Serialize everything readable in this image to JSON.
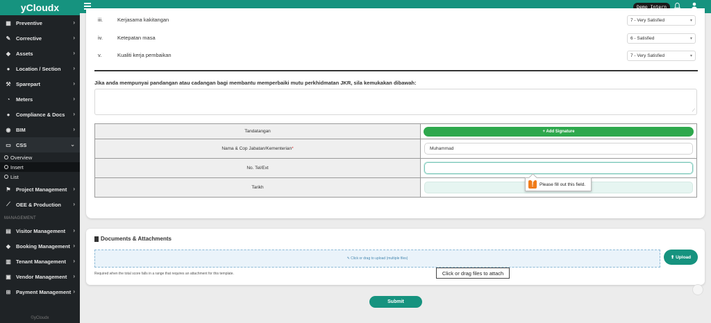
{
  "brand": "yCloudx",
  "sidebar": {
    "items": [
      {
        "label": "Preventive",
        "icon": "calendar-icon",
        "glyph": "▦"
      },
      {
        "label": "Corrective",
        "icon": "wrench-icon",
        "glyph": "✎"
      },
      {
        "label": "Assets",
        "icon": "tag-icon",
        "glyph": "◆"
      },
      {
        "label": "Location / Section",
        "icon": "location-icon",
        "glyph": "●"
      },
      {
        "label": "Sparepart",
        "icon": "tools-icon",
        "glyph": "⚒"
      },
      {
        "label": "Meters",
        "icon": "gauge-icon",
        "glyph": "◔"
      },
      {
        "label": "Compliance & Docs",
        "icon": "circle-icon",
        "glyph": "●"
      },
      {
        "label": "BIM",
        "icon": "cube-icon",
        "glyph": "◉"
      },
      {
        "label": "CSS",
        "icon": "monitor-icon",
        "glyph": "▭"
      }
    ],
    "css_sub": [
      {
        "label": "Overview"
      },
      {
        "label": "Insert"
      },
      {
        "label": "List"
      }
    ],
    "items2": [
      {
        "label": "Project Management",
        "icon": "project-icon",
        "glyph": "⚑"
      },
      {
        "label": "OEE & Production",
        "icon": "chart-line-icon",
        "glyph": "⟋"
      }
    ],
    "section": "MANAGEMENT",
    "items3": [
      {
        "label": "Visitor Management",
        "icon": "id-card-icon",
        "glyph": "▤"
      },
      {
        "label": "Booking Management",
        "icon": "booking-icon",
        "glyph": "◆"
      },
      {
        "label": "Tenant Management",
        "icon": "building-icon",
        "glyph": "▥"
      },
      {
        "label": "Vendor Management",
        "icon": "vendor-icon",
        "glyph": "▣"
      },
      {
        "label": "Payment Management",
        "icon": "cart-icon",
        "glyph": "⊞"
      }
    ],
    "footer": "©yCloudx"
  },
  "topbar": {
    "demo": "Demo Intern"
  },
  "questions": [
    {
      "num": "iii.",
      "text": "Kerjasama kakitangan",
      "rating": "7 - Very Satisfied"
    },
    {
      "num": "iv.",
      "text": "Ketepatan masa",
      "rating": "6 - Satisfied"
    },
    {
      "num": "v.",
      "text": "Kualiti kerja pembaikan",
      "rating": "7 - Very Satisfied"
    }
  ],
  "comment_label": "Jika anda mempunyai pandangan atau cadangan bagi membantu memperbaiki mutu perkhidmatan JKR, sila kemukakan dibawah:",
  "sig_table": {
    "signature_label": "Tandatangan",
    "add_signature": "+ Add Signature",
    "name_label": "Nama & Cop Jabatan/Kementerian",
    "name_value": "Muhammad",
    "phone_label": "No. Tel/Ext",
    "date_label": "Tarikh"
  },
  "tooltip": "Please fill out this field.",
  "docs": {
    "title": "Documents & Attachments",
    "dropzone": "✎ Click or drag to upload (multiple files)",
    "upload": "⬆ Upload",
    "help": "Required when the total score falls in a range that requires an attachment for this template.",
    "drag_tip": "Click or drag files to attach"
  },
  "submit": "Submit",
  "colors": {
    "brand": "#16937f",
    "sidebar": "#1f2326",
    "signature_button": "#2ea84d",
    "warning": "#f07c1a"
  }
}
